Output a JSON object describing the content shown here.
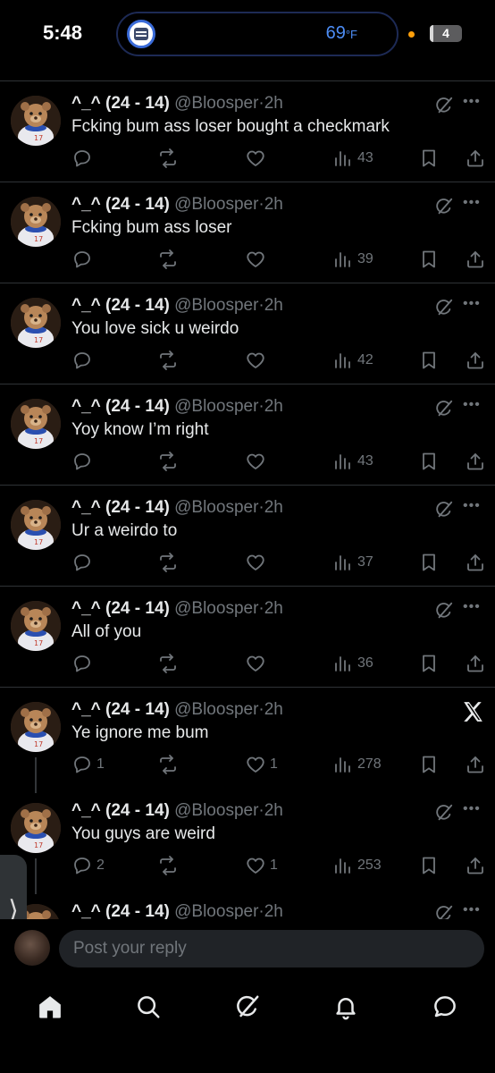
{
  "status_bar": {
    "time": "5:48",
    "temperature": "69",
    "temperature_unit": "°F",
    "battery": "4",
    "battery_level": 0.04
  },
  "colors": {
    "background": "#000000",
    "text_primary": "#e7e9ea",
    "text_secondary": "#71767b",
    "divider": "#2f3336",
    "island_border": "#1d2a55",
    "temp_blue": "#4d8df5"
  },
  "tweets": [
    {
      "name": "^_^ (24 - 14)",
      "handle": "@Bloosper",
      "sep": "·",
      "time": "2h",
      "text": "Fcking bum ass loser bought a checkmark",
      "replies": "",
      "likes": "",
      "views": "43",
      "show_x_logo": false
    },
    {
      "name": "^_^ (24 - 14)",
      "handle": "@Bloosper",
      "sep": "·",
      "time": "2h",
      "text": "Fcking bum ass loser",
      "replies": "",
      "likes": "",
      "views": "39",
      "show_x_logo": false
    },
    {
      "name": "^_^ (24 - 14)",
      "handle": "@Bloosper",
      "sep": "·",
      "time": "2h",
      "text": "You love sick u weirdo",
      "replies": "",
      "likes": "",
      "views": "42",
      "show_x_logo": false
    },
    {
      "name": "^_^ (24 - 14)",
      "handle": "@Bloosper",
      "sep": "·",
      "time": "2h",
      "text": "Yoy know I’m right",
      "replies": "",
      "likes": "",
      "views": "43",
      "show_x_logo": false
    },
    {
      "name": "^_^ (24 - 14)",
      "handle": "@Bloosper",
      "sep": "·",
      "time": "2h",
      "text": "Ur a weirdo to",
      "replies": "",
      "likes": "",
      "views": "37",
      "show_x_logo": false
    },
    {
      "name": "^_^ (24 - 14)",
      "handle": "@Bloosper",
      "sep": "·",
      "time": "2h",
      "text": "All of you",
      "replies": "",
      "likes": "",
      "views": "36",
      "show_x_logo": false
    },
    {
      "name": "^_^ (24 - 14)",
      "handle": "@Bloosper",
      "sep": "·",
      "time": "2h",
      "text": "Ye ignore me bum",
      "replies": "1",
      "likes": "1",
      "views": "278",
      "show_x_logo": true
    },
    {
      "name": "^_^ (24 - 14)",
      "handle": "@Bloosper",
      "sep": "·",
      "time": "2h",
      "text": "You guys are weird",
      "replies": "2",
      "likes": "1",
      "views": "253",
      "show_x_logo": false
    },
    {
      "name": "^_^ (24 - 14)",
      "handle": "@Bloosper",
      "sep": "·",
      "time": "2h",
      "text": "",
      "replies": "",
      "likes": "",
      "views": "",
      "show_x_logo": false
    }
  ],
  "side_handle": {
    "glyph": "⟩"
  },
  "reply_bar": {
    "placeholder": "Post your reply",
    "value": ""
  },
  "tab_bar": {
    "items": [
      "home-icon",
      "search-icon",
      "grok-icon",
      "bell-icon",
      "messages-icon"
    ]
  }
}
